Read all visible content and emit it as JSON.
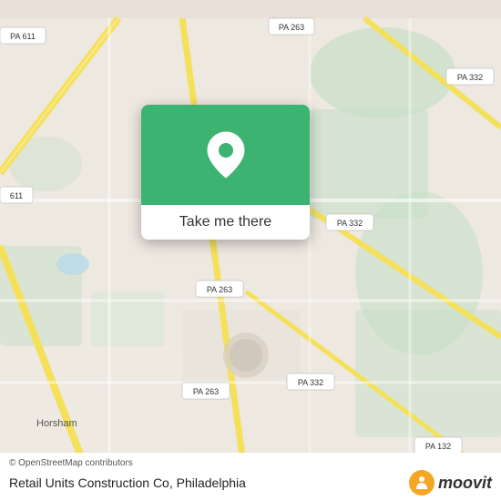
{
  "map": {
    "background_color": "#e8e0d8",
    "road_color_yellow": "#f5e66b",
    "road_color_light": "#ffffff",
    "park_color": "#c8dfc8",
    "water_color": "#b0d4e8"
  },
  "popup": {
    "button_label": "Take me there",
    "green_color": "#3cb371",
    "pin_color": "#ffffff"
  },
  "road_labels": [
    {
      "id": "pa611_top",
      "text": "PA 611"
    },
    {
      "id": "pa263_top",
      "text": "PA 263"
    },
    {
      "id": "pa332_right",
      "text": "PA 332"
    },
    {
      "id": "pa611_left",
      "text": "611"
    },
    {
      "id": "pa263_mid",
      "text": "PA 263"
    },
    {
      "id": "pa332_mid",
      "text": "PA 332"
    },
    {
      "id": "pa263_bottom",
      "text": "PA 263"
    },
    {
      "id": "pa132",
      "text": "PA 132"
    },
    {
      "id": "pa332_bottom",
      "text": "PA 332"
    }
  ],
  "bottom_bar": {
    "attribution": "© OpenStreetMap contributors",
    "place_name": "Retail Units Construction Co",
    "city": "Philadelphia",
    "moovit_label": "moovit"
  }
}
